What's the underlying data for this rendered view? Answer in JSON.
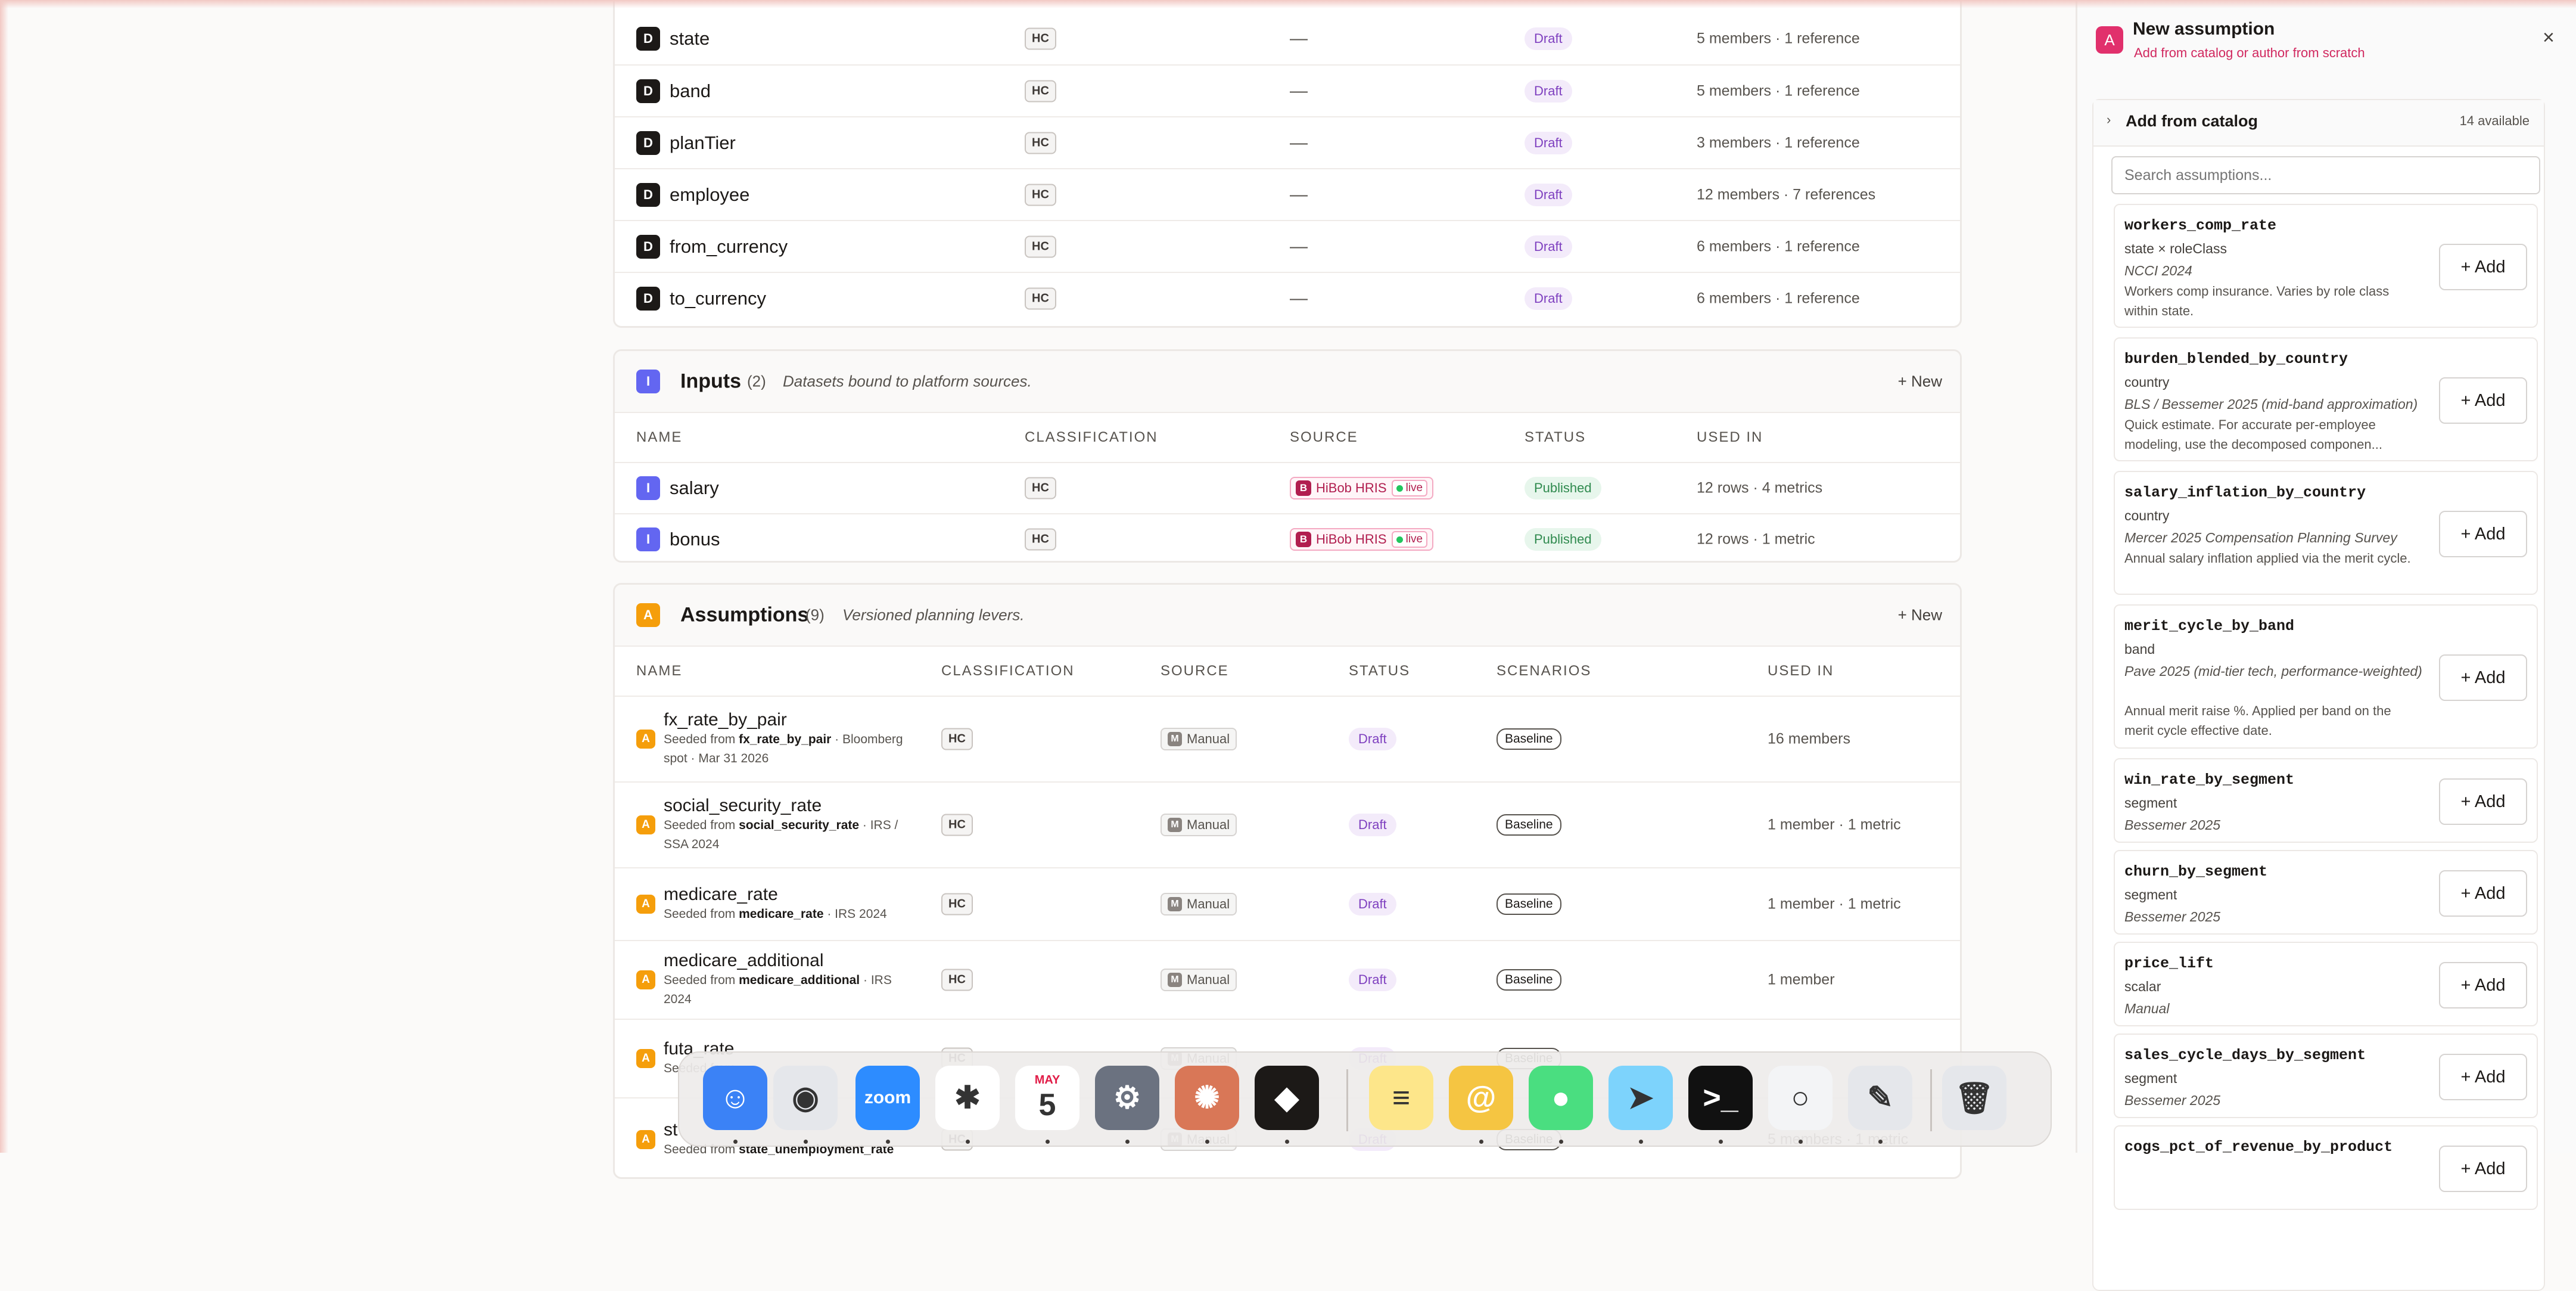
{
  "dimensions": {
    "rows": [
      {
        "icon": "D",
        "name": "state",
        "classification": "HC",
        "source": "—",
        "status": "Draft",
        "used_in": "5 members · 1 reference"
      },
      {
        "icon": "D",
        "name": "band",
        "classification": "HC",
        "source": "—",
        "status": "Draft",
        "used_in": "5 members · 1 reference"
      },
      {
        "icon": "D",
        "name": "planTier",
        "classification": "HC",
        "source": "—",
        "status": "Draft",
        "used_in": "3 members · 1 reference"
      },
      {
        "icon": "D",
        "name": "employee",
        "classification": "HC",
        "source": "—",
        "status": "Draft",
        "used_in": "12 members · 7 references"
      },
      {
        "icon": "D",
        "name": "from_currency",
        "classification": "HC",
        "source": "—",
        "status": "Draft",
        "used_in": "6 members · 1 reference"
      },
      {
        "icon": "D",
        "name": "to_currency",
        "classification": "HC",
        "source": "—",
        "status": "Draft",
        "used_in": "6 members · 1 reference"
      }
    ]
  },
  "inputs": {
    "icon": "I",
    "title": "Inputs",
    "count": "(2)",
    "description": "Datasets bound to platform sources.",
    "new_label": "+ New",
    "columns": [
      "NAME",
      "CLASSIFICATION",
      "SOURCE",
      "STATUS",
      "USED IN"
    ],
    "rows": [
      {
        "name": "salary",
        "classification": "HC",
        "source_badge": "B",
        "source": "HiBob HRIS",
        "live": "live",
        "status": "Published",
        "used_in": "12 rows · 4 metrics"
      },
      {
        "name": "bonus",
        "classification": "HC",
        "source_badge": "B",
        "source": "HiBob HRIS",
        "live": "live",
        "status": "Published",
        "used_in": "12 rows · 1 metric"
      }
    ]
  },
  "assumptions": {
    "icon": "A",
    "title": "Assumptions",
    "count": "(9)",
    "description": "Versioned planning levers.",
    "new_label": "+ New",
    "columns": [
      "NAME",
      "CLASSIFICATION",
      "SOURCE",
      "STATUS",
      "SCENARIOS",
      "USED IN"
    ],
    "rows": [
      {
        "name": "fx_rate_by_pair",
        "seed_prefix": "Seeded from ",
        "seed_name": "fx_rate_by_pair",
        "seed_suffix": " · Bloomberg spot · Mar 31 2026",
        "classification": "HC",
        "source_badge": "M",
        "source": "Manual",
        "status": "Draft",
        "scenario": "Baseline",
        "used_in": "16 members"
      },
      {
        "name": "social_security_rate",
        "seed_prefix": "Seeded from ",
        "seed_name": "social_security_rate",
        "seed_suffix": " · IRS / SSA 2024",
        "classification": "HC",
        "source_badge": "M",
        "source": "Manual",
        "status": "Draft",
        "scenario": "Baseline",
        "used_in": "1 member · 1 metric"
      },
      {
        "name": "medicare_rate",
        "seed_prefix": "Seeded from ",
        "seed_name": "medicare_rate",
        "seed_suffix": " · IRS 2024",
        "classification": "HC",
        "source_badge": "M",
        "source": "Manual",
        "status": "Draft",
        "scenario": "Baseline",
        "used_in": "1 member · 1 metric"
      },
      {
        "name": "medicare_additional",
        "seed_prefix": "Seeded from ",
        "seed_name": "medicare_additional",
        "seed_suffix": " · IRS 2024",
        "classification": "HC",
        "source_badge": "M",
        "source": "Manual",
        "status": "Draft",
        "scenario": "Baseline",
        "used_in": "1 member"
      },
      {
        "name": "futa_rate",
        "seed_prefix": "Seeded from ",
        "seed_name": "",
        "seed_suffix": "",
        "classification": "HC",
        "source_badge": "M",
        "source": "Manual",
        "status": "Draft",
        "scenario": "Baseline",
        "used_in": ""
      },
      {
        "name": "st",
        "seed_prefix": "Seeded from ",
        "seed_name": "state_unemployment_rate",
        "seed_suffix": "",
        "classification": "HC",
        "source_badge": "M",
        "source": "Manual",
        "status": "Draft",
        "scenario": "Baseline",
        "used_in": "5 members · 1 metric"
      }
    ]
  },
  "panel": {
    "logo": "A",
    "title": "New assumption",
    "subtitle": "Add from catalog or author from scratch",
    "close": "×",
    "catalog_caret": "›",
    "catalog_title": "Add from catalog",
    "catalog_count": "14 available",
    "search_placeholder": "Search assumptions...",
    "add_label": "+ Add",
    "items": [
      {
        "name": "workers_comp_rate",
        "dims": "state × roleClass",
        "source": "NCCI 2024",
        "desc": "Workers comp insurance. Varies by role class within state."
      },
      {
        "name": "burden_blended_by_country",
        "dims": "country",
        "source": "BLS / Bessemer 2025 (mid-band approximation)",
        "desc": "Quick estimate. For accurate per-employee modeling, use the decomposed componen..."
      },
      {
        "name": "salary_inflation_by_country",
        "dims": "country",
        "source": "Mercer 2025 Compensation Planning Survey",
        "desc": "Annual salary inflation applied via the merit cycle."
      },
      {
        "name": "merit_cycle_by_band",
        "dims": "band",
        "source": "Pave 2025 (mid-tier tech, performance-weighted)",
        "desc": "Annual merit raise %. Applied per band on the merit cycle effective date."
      },
      {
        "name": "win_rate_by_segment",
        "dims": "segment",
        "source": "Bessemer 2025",
        "desc": ""
      },
      {
        "name": "churn_by_segment",
        "dims": "segment",
        "source": "Bessemer 2025",
        "desc": ""
      },
      {
        "name": "price_lift",
        "dims": "scalar",
        "source": "Manual",
        "desc": ""
      },
      {
        "name": "sales_cycle_days_by_segment",
        "dims": "segment",
        "source": "Bessemer 2025",
        "desc": ""
      },
      {
        "name": "cogs_pct_of_revenue_by_product",
        "dims": "",
        "source": "",
        "desc": ""
      }
    ]
  },
  "dock": {
    "apps": [
      {
        "name": "finder-icon",
        "glyph": "☺",
        "color": "#3b82f6"
      },
      {
        "name": "chrome-icon",
        "glyph": "◉",
        "color": "#e5e7eb"
      },
      {
        "name": "zoom-icon",
        "glyph": "zoom",
        "color": "#2d8cff"
      },
      {
        "name": "slack-icon",
        "glyph": "✱",
        "color": "#ffffff"
      },
      {
        "name": "calendar-icon",
        "glyph": "5",
        "month": "MAY",
        "color": "#ffffff"
      },
      {
        "name": "system-settings-icon",
        "glyph": "⚙",
        "color": "#6b7280"
      },
      {
        "name": "claude-icon",
        "glyph": "✺",
        "color": "#d97757"
      },
      {
        "name": "cube-app-icon",
        "glyph": "◆",
        "color": "#1c1917"
      },
      {
        "name": "notes-icon",
        "glyph": "≡",
        "color": "#fde68a"
      },
      {
        "name": "spiral-app-icon",
        "glyph": "@",
        "color": "#f5c542"
      },
      {
        "name": "messages-icon",
        "glyph": "●",
        "color": "#4ade80"
      },
      {
        "name": "maps-icon",
        "glyph": "➤",
        "color": "#7dd3fc"
      },
      {
        "name": "terminal-icon",
        "glyph": ">_",
        "color": "#111111"
      },
      {
        "name": "circle-app-icon",
        "glyph": "○",
        "color": "#f3f4f6"
      },
      {
        "name": "textedit-icon",
        "glyph": "✎",
        "color": "#e5e7eb"
      },
      {
        "name": "trash-icon",
        "glyph": "🗑",
        "color": "#e5e7eb"
      }
    ]
  }
}
